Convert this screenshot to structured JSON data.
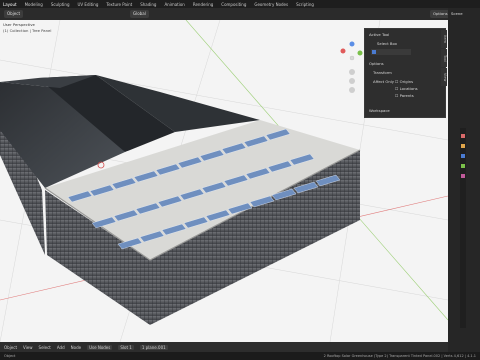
{
  "menu": {
    "items": [
      "Layout",
      "Modeling",
      "Sculpting",
      "UV Editing",
      "Texture Paint",
      "Shading",
      "Animation",
      "Rendering",
      "Compositing",
      "Geometry Nodes",
      "Scripting"
    ],
    "active_index": 0,
    "scene": "Scene"
  },
  "header": {
    "mode": "Object",
    "orientation": "Global",
    "options": "Options"
  },
  "viewport": {
    "view_label": "User Perspective",
    "collection_label": "(1) Collection | Tree Panel"
  },
  "npanel": {
    "active_tool_title": "Active Tool",
    "select_box": "Select Box",
    "options_title": "Options",
    "transform_title": "Transform",
    "affect_only": "Affect Only",
    "checks": [
      "Origins",
      "Locations",
      "Parents"
    ],
    "workspace_title": "Workspace",
    "tabs": [
      "Item",
      "Tool",
      "View"
    ]
  },
  "bottombar": {
    "items": [
      "Object",
      "View",
      "Select",
      "Add",
      "Node"
    ],
    "use_nodes": "Use Nodes",
    "slot": "Slot 1",
    "material": "1 plane.001"
  },
  "statusbar": {
    "left": "Object",
    "right": "2 Rooftop Solar Greenhouse (Type 2) Transparent Tinted Panel.002 | Verts 4,612 | 4.1.1"
  },
  "colors": {
    "accent": "#4a7bd1",
    "background": "#f4f4f4",
    "panel": "#2e2e2e"
  }
}
